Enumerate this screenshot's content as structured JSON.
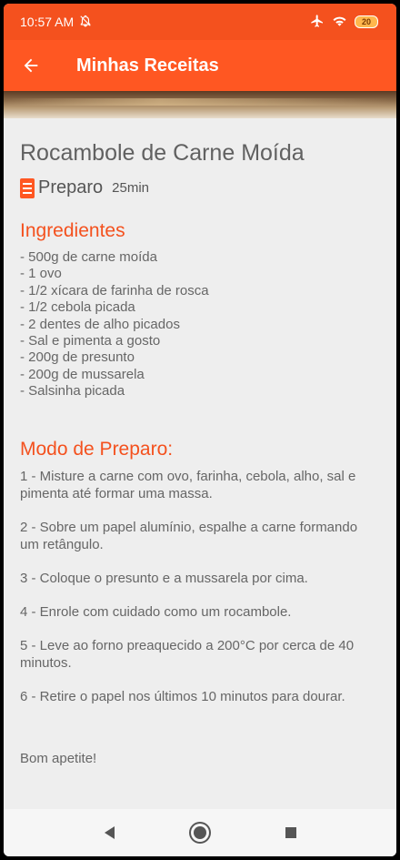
{
  "status": {
    "time": "10:57 AM",
    "battery": "20"
  },
  "appbar": {
    "title": "Minhas Receitas",
    "back_icon": "arrow-left-icon"
  },
  "recipe": {
    "title": "Rocambole de Carne Moída",
    "prep_label": "Preparo",
    "prep_time": "25min",
    "ingredients_title": "Ingredientes",
    "ingredients": [
      "- 500g de carne moída",
      "- 1 ovo",
      "- 1/2 xícara de farinha de rosca",
      "- 1/2 cebola picada",
      "- 2 dentes de alho picados",
      "- Sal e pimenta a gosto",
      "- 200g de presunto",
      "- 200g de mussarela",
      "- Salsinha picada"
    ],
    "steps_title": "Modo de Preparo:",
    "steps": [
      "1 - Misture a carne com ovo, farinha, cebola, alho, sal e pimenta até formar uma massa.",
      "2 - Sobre um papel alumínio, espalhe a carne formando um retângulo.",
      "3 - Coloque o presunto e a mussarela por cima.",
      "4 - Enrole com cuidado como um rocambole.",
      "5 - Leve ao forno preaquecido a 200°C por cerca de 40 minutos.",
      "6 - Retire o papel nos últimos 10 minutos para dourar."
    ],
    "closing": "Bom apetite!"
  },
  "colors": {
    "statusbar": "#f4511e",
    "appbar": "#ff5722",
    "accent": "#f4511e"
  }
}
